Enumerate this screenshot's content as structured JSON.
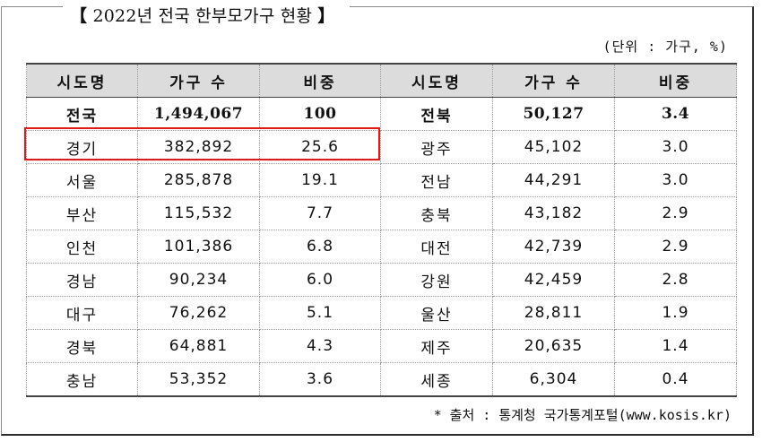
{
  "title": {
    "open_bracket": "【",
    "text_num": "2022",
    "text_rest": "년 전국 한부모가구 현황",
    "close_bracket": "】"
  },
  "unit_note": "(단위 : 가구, %)",
  "table": {
    "headers": [
      "시도명",
      "가구 수",
      "비중",
      "시도명",
      "가구 수",
      "비중"
    ],
    "rows": [
      [
        "전국",
        "1,494,067",
        "100",
        "전북",
        "50,127",
        "3.4"
      ],
      [
        "경기",
        "382,892",
        "25.6",
        "광주",
        "45,102",
        "3.0"
      ],
      [
        "서울",
        "285,878",
        "19.1",
        "전남",
        "44,291",
        "3.0"
      ],
      [
        "부산",
        "115,532",
        "7.7",
        "충북",
        "43,182",
        "2.9"
      ],
      [
        "인천",
        "101,386",
        "6.8",
        "대전",
        "42,739",
        "2.9"
      ],
      [
        "경남",
        "90,234",
        "6.0",
        "강원",
        "42,459",
        "2.8"
      ],
      [
        "대구",
        "76,262",
        "5.1",
        "울산",
        "28,811",
        "1.9"
      ],
      [
        "경북",
        "64,881",
        "4.3",
        "제주",
        "20,635",
        "1.4"
      ],
      [
        "충남",
        "53,352",
        "3.6",
        "세종",
        "6,304",
        "0.4"
      ]
    ]
  },
  "highlight": {
    "color": "#e01818",
    "row": "경기"
  },
  "source": "* 출처 : 통계청 국가통계포털(www.kosis.kr)"
}
